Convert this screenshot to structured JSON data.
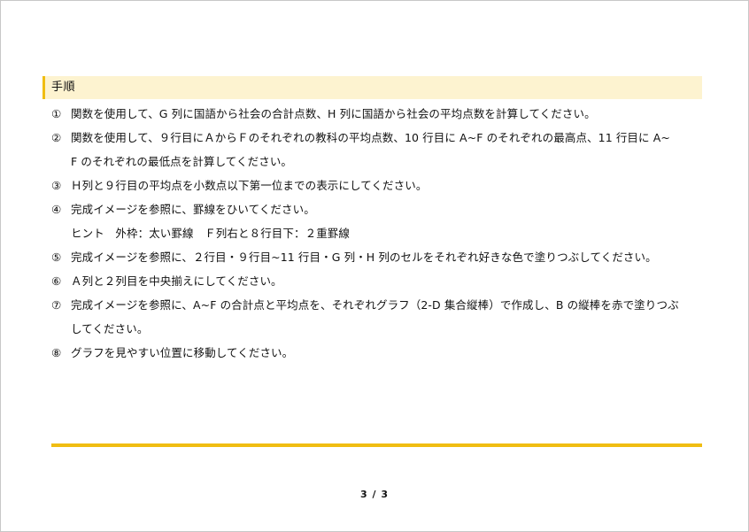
{
  "section": {
    "title": "手順"
  },
  "steps": [
    {
      "num": "①",
      "lines": [
        "関数を使用して、G 列に国語から社会の合計点数、H 列に国語から社会の平均点数を計算してください。"
      ]
    },
    {
      "num": "②",
      "lines": [
        "関数を使用して、９行目にＡからＦのそれぞれの教科の平均点数、10 行目に A~F のそれぞれの最高点、11 行目に A~",
        "F のそれぞれの最低点を計算してください。"
      ]
    },
    {
      "num": "③",
      "lines": [
        "Ｈ列と９行目の平均点を小数点以下第一位までの表示にしてください。"
      ]
    },
    {
      "num": "④",
      "lines": [
        "完成イメージを参照に、罫線をひいてください。",
        "ヒント　外枠：太い罫線　Ｆ列右と８行目下：２重罫線"
      ]
    },
    {
      "num": "⑤",
      "lines": [
        "完成イメージを参照に、２行目・９行目~11 行目・G 列・H 列のセルをそれぞれ好きな色で塗りつぶしてください。"
      ]
    },
    {
      "num": "⑥",
      "lines": [
        "Ａ列と２列目を中央揃えにしてください。"
      ]
    },
    {
      "num": "⑦",
      "lines": [
        "完成イメージを参照に、A~F の合計点と平均点を、それぞれグラフ（2-D 集合縦棒）で作成し、B の縦棒を赤で塗りつぶ",
        "してください。"
      ]
    },
    {
      "num": "⑧",
      "lines": [
        "グラフを見やすい位置に移動してください。"
      ]
    }
  ],
  "footer": {
    "page_number": "3 / 3"
  },
  "colors": {
    "accent": "#f0bd12",
    "header_background": "#fdf3d0"
  }
}
